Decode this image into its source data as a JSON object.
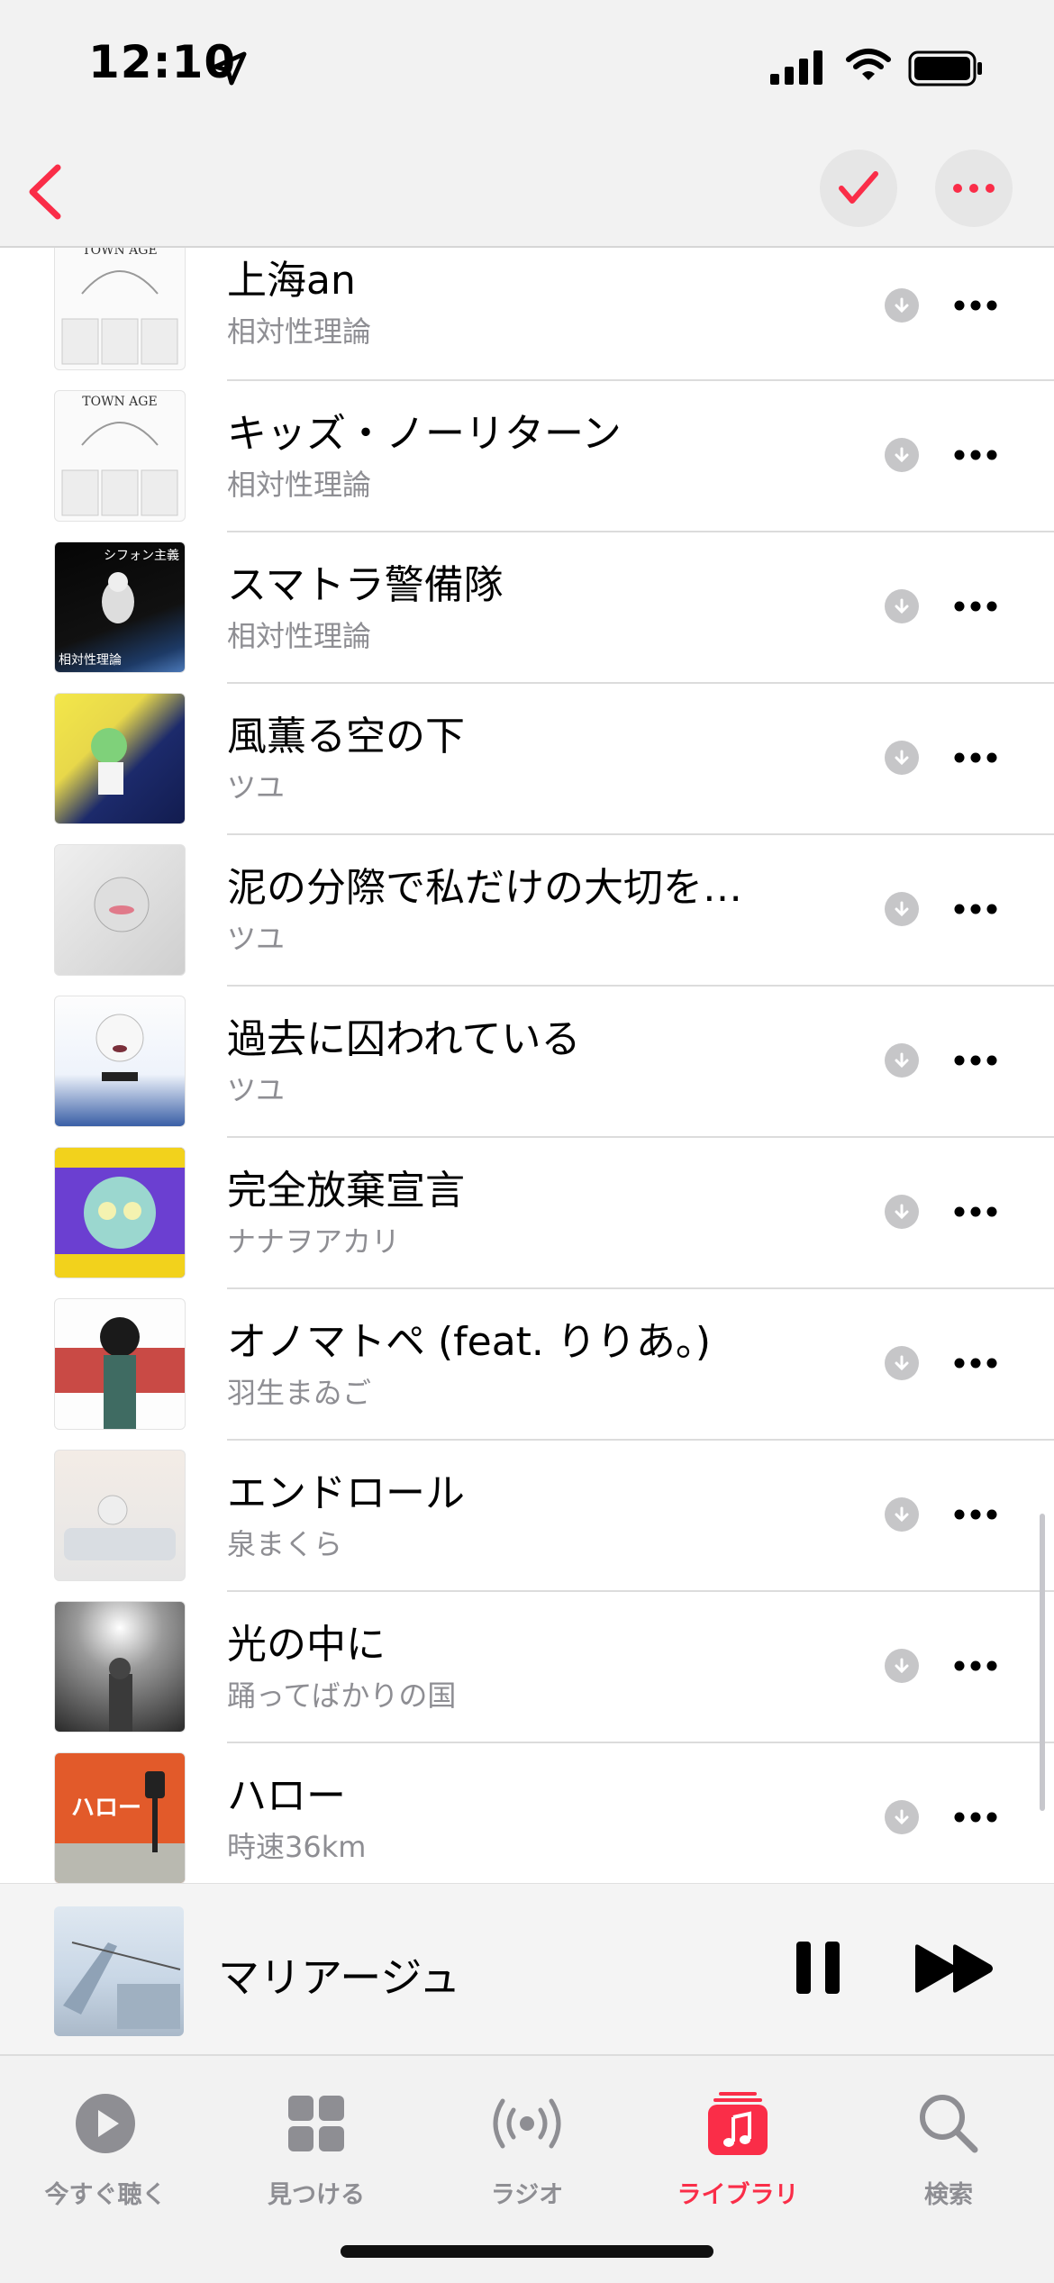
{
  "status": {
    "time": "12:10"
  },
  "songs": [
    {
      "title": "上海an",
      "artist": "相対性理論"
    },
    {
      "title": "キッズ・ノーリターン",
      "artist": "相対性理論"
    },
    {
      "title": "スマトラ警備隊",
      "artist": "相対性理論"
    },
    {
      "title": "風薫る空の下",
      "artist": "ツユ"
    },
    {
      "title": "泥の分際で私だけの大切を…",
      "artist": "ツユ"
    },
    {
      "title": "過去に囚われている",
      "artist": "ツユ"
    },
    {
      "title": "完全放棄宣言",
      "artist": "ナナヲアカリ"
    },
    {
      "title": "オノマトペ (feat. りりあ。)",
      "artist": "羽生まゐご"
    },
    {
      "title": "エンドロール",
      "artist": "泉まくら"
    },
    {
      "title": "光の中に",
      "artist": "踊ってばかりの国"
    },
    {
      "title": "ハロー",
      "artist": "時速36km"
    }
  ],
  "artwork_text": {
    "town_age_1": "TOWN AGE",
    "town_age_2": "TOWN AGE",
    "chiffon_top": "シフォン主義",
    "chiffon_bottom": "相対性理論",
    "hello": "ハロー"
  },
  "now_playing": {
    "title": "マリアージュ"
  },
  "tabs": [
    {
      "label": "今すぐ聴く",
      "icon": "play-circle-icon"
    },
    {
      "label": "見つける",
      "icon": "grid-icon"
    },
    {
      "label": "ラジオ",
      "icon": "radio-icon"
    },
    {
      "label": "ライブラリ",
      "icon": "music-library-icon",
      "active": true
    },
    {
      "label": "検索",
      "icon": "search-icon"
    }
  ],
  "colors": {
    "accent": "#fa2d48",
    "secondary_text": "#8e8e93"
  }
}
